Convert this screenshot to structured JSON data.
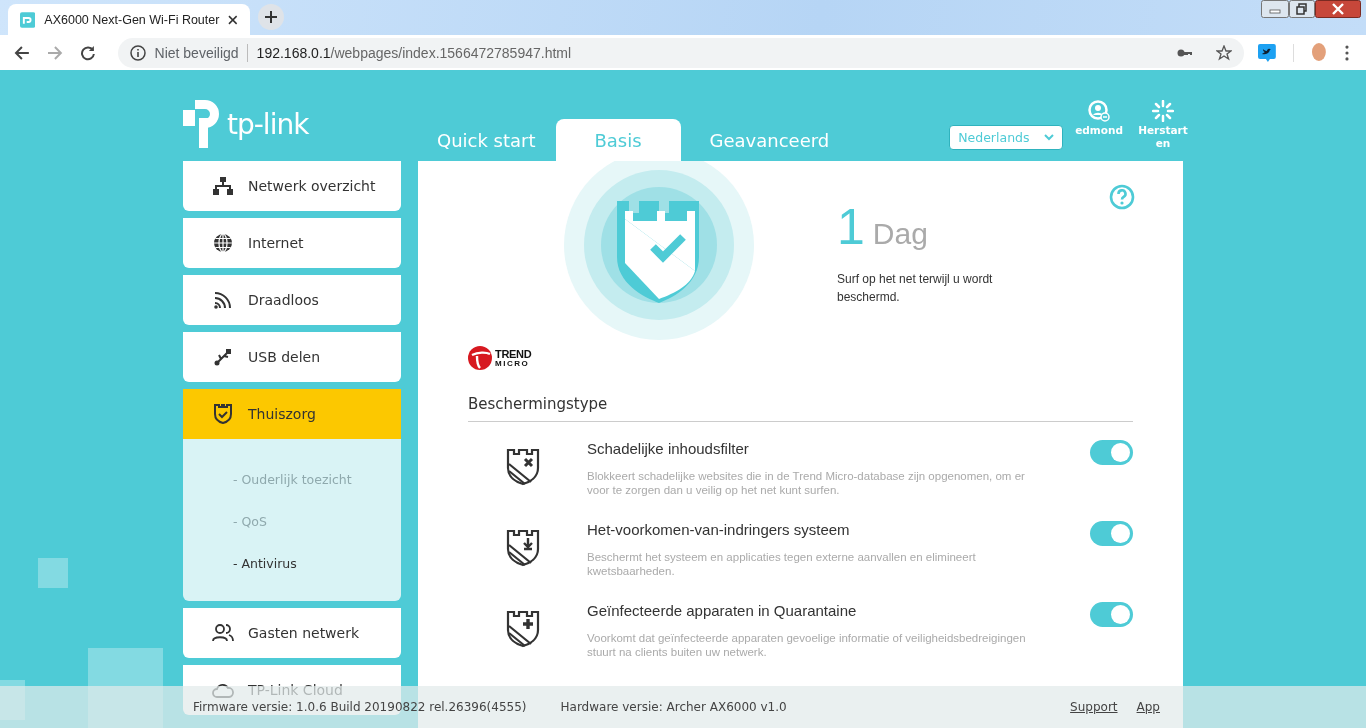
{
  "browser": {
    "tab_title": "AX6000 Next-Gen Wi-Fi Router",
    "security": "Niet beveiligd",
    "url_host": "192.168.0.1",
    "url_path": "/webpages/index.1566472785947.html"
  },
  "header": {
    "logo": "tp-link",
    "tabs": [
      {
        "label": "Quick start",
        "selected": false
      },
      {
        "label": "Basis",
        "selected": true
      },
      {
        "label": "Geavanceerd",
        "selected": false
      }
    ],
    "language": "Nederlands",
    "user": "edmond",
    "restart": "Herstarten"
  },
  "sidebar": {
    "items": [
      {
        "label": "Netwerk overzicht",
        "selected": false
      },
      {
        "label": "Internet",
        "selected": false
      },
      {
        "label": "Draadloos",
        "selected": false
      },
      {
        "label": "USB delen",
        "selected": false
      },
      {
        "label": "Thuiszorg",
        "selected": true,
        "expanded": true,
        "children": [
          {
            "label": "- Ouderlijk toezicht",
            "selected": false
          },
          {
            "label": "- QoS",
            "selected": false
          },
          {
            "label": "- Antivirus",
            "selected": true
          }
        ]
      },
      {
        "label": "Gasten netwerk",
        "selected": false
      },
      {
        "label": "TP-Link Cloud",
        "selected": false
      }
    ]
  },
  "hero": {
    "number": "1",
    "unit": "Dag",
    "caption": "Surf op het net terwijl u wordt beschermd."
  },
  "brand": {
    "name": "TREND",
    "sub": "MICRO"
  },
  "section_title": "Beschermingstype",
  "features": [
    {
      "title": "Schadelijke inhoudsfilter",
      "description": "Blokkeert schadelijke websites die in de Trend Micro-database zijn opgenomen, om er voor te zorgen dan u veilig op het net kunt surfen.",
      "on": true
    },
    {
      "title": "Het-voorkomen-van-indringers systeem",
      "description": "Beschermt het systeem en applicaties tegen externe aanvallen en elimineert kwetsbaarheden.",
      "on": true
    },
    {
      "title": "Geïnfecteerde apparaten in Quarantaine",
      "description": "Voorkomt dat geïnfecteerde apparaten gevoelige informatie of veiligheidsbedreigingen stuurt na clients buiten uw netwerk.",
      "on": true
    }
  ],
  "footer": {
    "firmware": "Firmware versie: 1.0.6 Build 20190822 rel.26396(4555)",
    "hardware": "Hardware versie: Archer AX6000 v1.0",
    "links": [
      "Support",
      "App"
    ]
  }
}
